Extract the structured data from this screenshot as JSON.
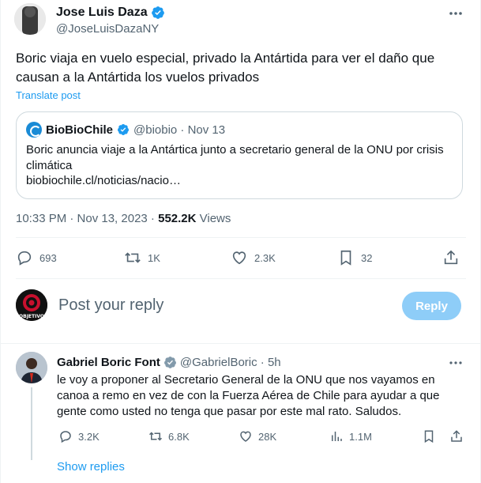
{
  "post": {
    "display_name": "Jose Luis Daza",
    "handle": "@JoseLuisDazaNY",
    "text": "Boric viaja en vuelo especial, privado la Antártida para ver el daño que causan a la Antártida los vuelos privados",
    "translate_label": "Translate post",
    "timestamp": "10:33 PM · Nov 13, 2023 · ",
    "views_count": "552.2K",
    "views_label": " Views",
    "actions": {
      "replies": "693",
      "reposts": "1K",
      "likes": "2.3K",
      "bookmarks": "32"
    }
  },
  "quote": {
    "display_name": "BioBioChile",
    "meta": "@biobio · Nov 13",
    "text": "Boric anuncia viaje a la Antártica junto a secretario general de la ONU por crisis climática",
    "link": "biobiochile.cl/noticias/nacio…"
  },
  "composer": {
    "placeholder": "Post your reply",
    "reply_button": "Reply",
    "avatar_text": "OBJETIVO"
  },
  "reply": {
    "display_name": "Gabriel Boric Font",
    "meta": "@GabrielBoric · 5h",
    "text": "le voy a proponer al Secretario General de la ONU que nos vayamos en canoa a remo en vez de con la Fuerza Aérea de Chile para ayudar a que gente como usted no tenga que pasar por este mal rato. Saludos.",
    "actions": {
      "replies": "3.2K",
      "reposts": "6.8K",
      "likes": "28K",
      "views": "1.1M"
    },
    "show_replies": "Show replies"
  },
  "colors": {
    "accent": "#1d9bf0",
    "secondary_text": "#536471",
    "reply_button_disabled": "#8ecdf8"
  }
}
